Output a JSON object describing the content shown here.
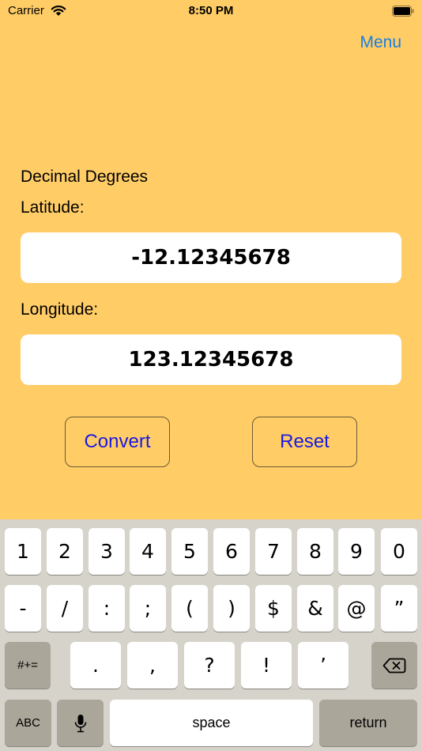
{
  "status_bar": {
    "carrier": "Carrier",
    "time": "8:50 PM"
  },
  "nav": {
    "menu_label": "Menu"
  },
  "form": {
    "section_title": "Decimal Degrees",
    "latitude_label": "Latitude:",
    "latitude_value": "-12.12345678",
    "longitude_label": "Longitude:",
    "longitude_value": "123.12345678"
  },
  "buttons": {
    "convert": "Convert",
    "reset": "Reset"
  },
  "keyboard": {
    "row1": [
      "1",
      "2",
      "3",
      "4",
      "5",
      "6",
      "7",
      "8",
      "9",
      "0"
    ],
    "row2": [
      "-",
      "/",
      ":",
      ";",
      "(",
      ")",
      "$",
      "&",
      "@",
      "”"
    ],
    "row3_mode": "#+=",
    "row3": [
      ".",
      ",",
      "?",
      "!",
      "’"
    ],
    "row3_delete_icon": "backspace-icon",
    "row4": {
      "abc": "ABC",
      "mic_icon": "microphone-icon",
      "space": "space",
      "return": "return"
    }
  },
  "colors": {
    "background": "#ffcc66",
    "link": "#1a7fe0",
    "button_text": "#1a1ae0",
    "keyboard_bg": "#d6d3cb",
    "func_key": "#aba69a"
  }
}
